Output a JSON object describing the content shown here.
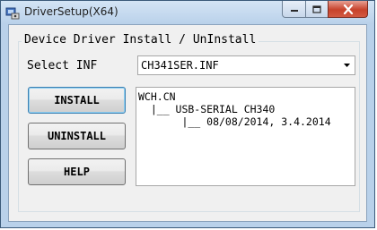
{
  "window": {
    "title": "DriverSetup(X64)",
    "icons": {
      "app": "driver-setup-icon",
      "minimize": "minimize-icon",
      "maximize": "maximize-icon",
      "close": "close-icon"
    }
  },
  "group": {
    "title": "Device Driver Install / UnInstall"
  },
  "select_inf": {
    "label": "Select INF",
    "value": "CH341SER.INF",
    "icon": "chevron-down-icon"
  },
  "buttons": {
    "install": "INSTALL",
    "uninstall": "UNINSTALL",
    "help": "HELP"
  },
  "info": {
    "lines": [
      "WCH.CN",
      "  |__ USB-SERIAL CH340",
      "       |__ 08/08/2014, 3.4.2014"
    ]
  },
  "colors": {
    "titlebar": "#b9d1ea",
    "close_button": "#c7422b",
    "default_button_border": "#3c7fb1"
  }
}
